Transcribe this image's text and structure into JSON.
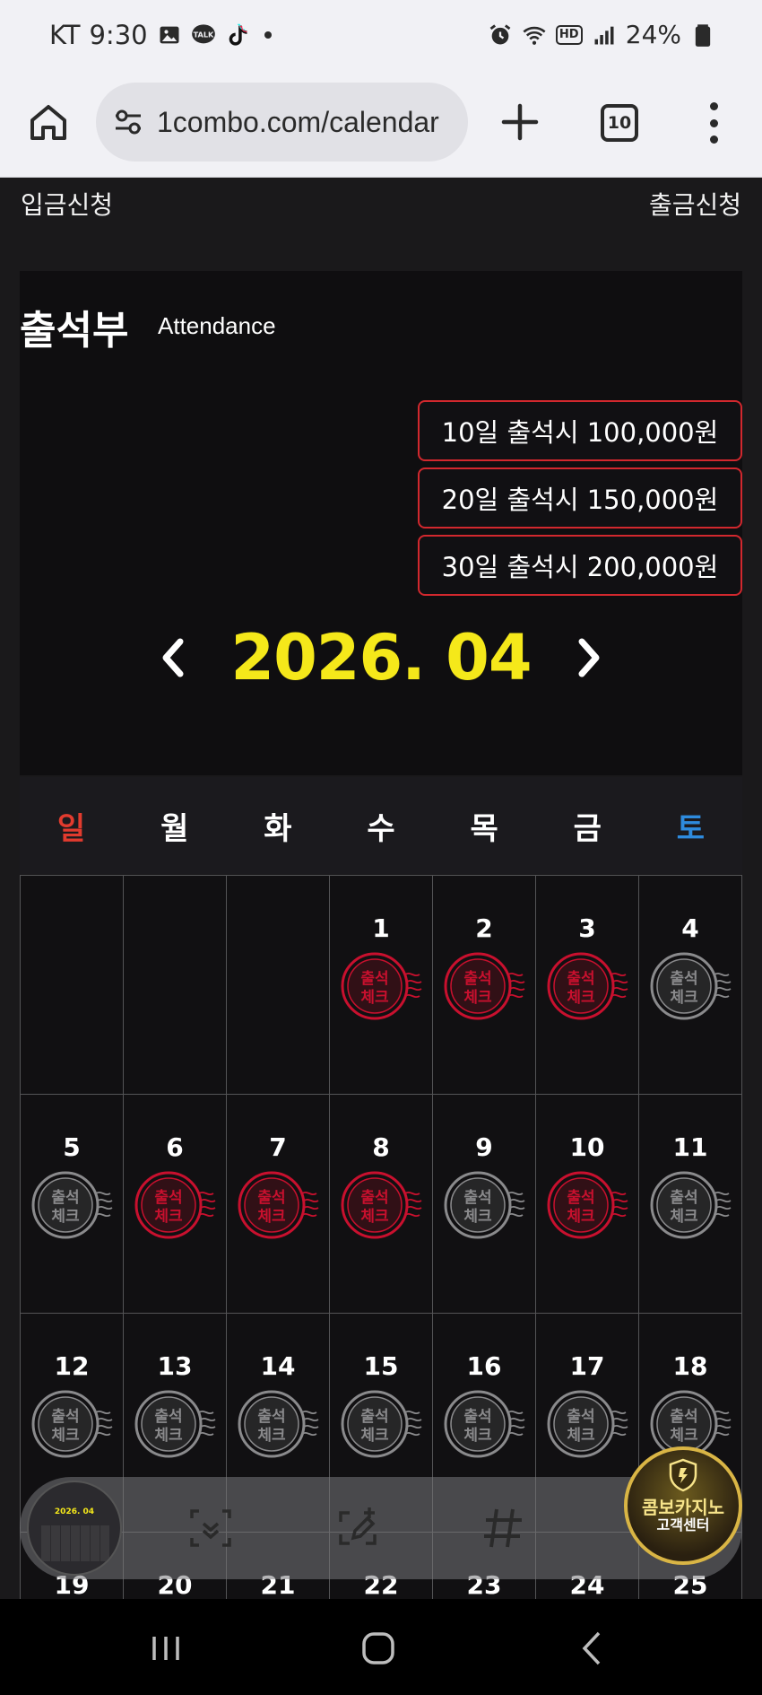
{
  "status_bar": {
    "carrier": "KT",
    "time": "9:30",
    "left_icons": [
      "gallery-icon",
      "kakaotalk-icon",
      "tiktok-icon",
      "notification-dot-icon"
    ],
    "talk_badge": "TALK",
    "right_icons": [
      "alarm-icon",
      "wifi-icon",
      "hd-voice-icon",
      "signal-icon",
      "battery-icon"
    ],
    "hd_label": "HD",
    "battery": "24%"
  },
  "browser": {
    "url": "1combo.com/calendar",
    "tab_count": "10"
  },
  "topnav": {
    "deposit_label": "입금신청",
    "withdraw_label": "출금신청"
  },
  "attendance": {
    "title": "출석부",
    "subtitle": "Attendance",
    "rewards": [
      "10일 출석시 100,000원",
      "20일 출석시 150,000원",
      "30일 출석시 200,000원"
    ],
    "month_label": "2026. 04"
  },
  "calendar": {
    "weekdays": [
      "일",
      "월",
      "화",
      "수",
      "목",
      "금",
      "토"
    ],
    "stamp_text_top": "출석",
    "stamp_text_bottom": "체크",
    "checked_color": "#c8102e",
    "unchecked_color": "#8a8a8c",
    "days": [
      {
        "day": "",
        "stamp": "none"
      },
      {
        "day": "",
        "stamp": "none"
      },
      {
        "day": "",
        "stamp": "none"
      },
      {
        "day": "1",
        "stamp": "checked"
      },
      {
        "day": "2",
        "stamp": "checked"
      },
      {
        "day": "3",
        "stamp": "checked"
      },
      {
        "day": "4",
        "stamp": "unchecked"
      },
      {
        "day": "5",
        "stamp": "unchecked"
      },
      {
        "day": "6",
        "stamp": "checked"
      },
      {
        "day": "7",
        "stamp": "checked"
      },
      {
        "day": "8",
        "stamp": "checked"
      },
      {
        "day": "9",
        "stamp": "unchecked"
      },
      {
        "day": "10",
        "stamp": "checked"
      },
      {
        "day": "11",
        "stamp": "unchecked"
      },
      {
        "day": "12",
        "stamp": "unchecked"
      },
      {
        "day": "13",
        "stamp": "unchecked"
      },
      {
        "day": "14",
        "stamp": "unchecked"
      },
      {
        "day": "15",
        "stamp": "unchecked"
      },
      {
        "day": "16",
        "stamp": "unchecked"
      },
      {
        "day": "17",
        "stamp": "unchecked"
      },
      {
        "day": "18",
        "stamp": "unchecked"
      },
      {
        "day": "19",
        "stamp": "none"
      },
      {
        "day": "20",
        "stamp": "none"
      },
      {
        "day": "21",
        "stamp": "none"
      },
      {
        "day": "22",
        "stamp": "none"
      },
      {
        "day": "23",
        "stamp": "none"
      },
      {
        "day": "24",
        "stamp": "none"
      },
      {
        "day": "25",
        "stamp": "none"
      }
    ]
  },
  "floating_toolbar": {
    "thumbnail_label": "2026. 04",
    "buttons": [
      "scan-icon",
      "edit-capture-icon",
      "hashtag-icon"
    ]
  },
  "support_badge": {
    "line1": "콤보카지노",
    "line2": "고객센터"
  },
  "nav_bar": [
    "recent-apps-icon",
    "home-icon",
    "back-icon"
  ],
  "colors": {
    "accent_yellow": "#f5e81a",
    "reward_border": "#d2282e",
    "sunday": "#e23b2e",
    "saturday": "#2e8bde"
  }
}
